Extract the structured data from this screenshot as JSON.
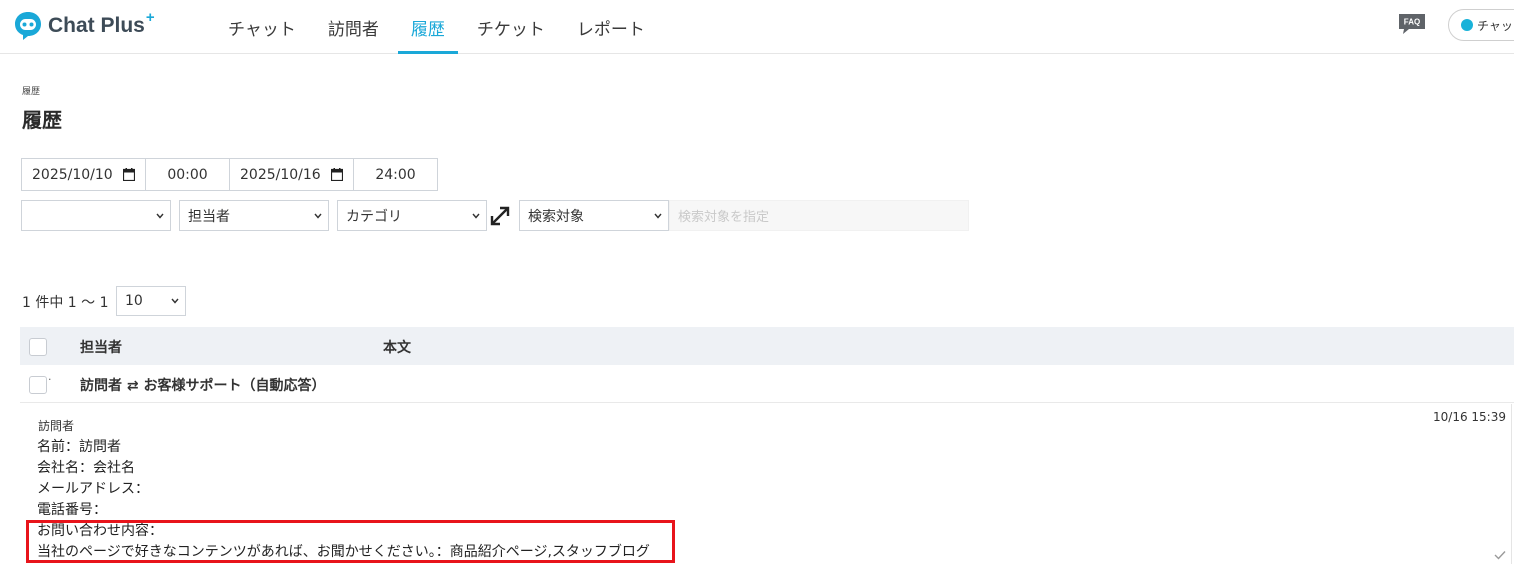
{
  "header": {
    "logo_text": "Chat Plus",
    "logo_plus": "+",
    "nav": [
      {
        "label": "チャット",
        "active": false
      },
      {
        "label": "訪問者",
        "active": false
      },
      {
        "label": "履歴",
        "active": true
      },
      {
        "label": "チケット",
        "active": false
      },
      {
        "label": "レポート",
        "active": false
      }
    ],
    "faq_label": "FAQ",
    "status_label": "チャッ",
    "accent_color": "#1aa8d8"
  },
  "page": {
    "breadcrumb": "履歴",
    "title": "履歴"
  },
  "filters": {
    "start_date": "2025/10/10",
    "start_time": "00:00",
    "end_date": "2025/10/16",
    "end_time": "24:00",
    "select_1": "",
    "assignee_select": "担当者",
    "category_select": "カテゴリ",
    "search_target_select": "検索対象",
    "search_placeholder": "検索対象を指定"
  },
  "pagination": {
    "count_text": "1 件中 1 〜 1",
    "per_page": "10"
  },
  "table": {
    "headers": [
      "担当者",
      "本文"
    ],
    "rows": [
      {
        "dot": "·",
        "title": "訪問者 ⇄ お客様サポート（自動応答）"
      }
    ]
  },
  "detail": {
    "sender": "訪問者",
    "timestamp": "10/16 15:39",
    "lines": [
      "名前：訪問者",
      "会社名：会社名",
      "メールアドレス：",
      "電話番号：",
      "お問い合わせ内容：",
      "当社のページで好きなコンテンツがあれば、お聞かせください。：商品紹介ページ,スタッフブログ"
    ],
    "highlight_color": "#e8141b"
  }
}
